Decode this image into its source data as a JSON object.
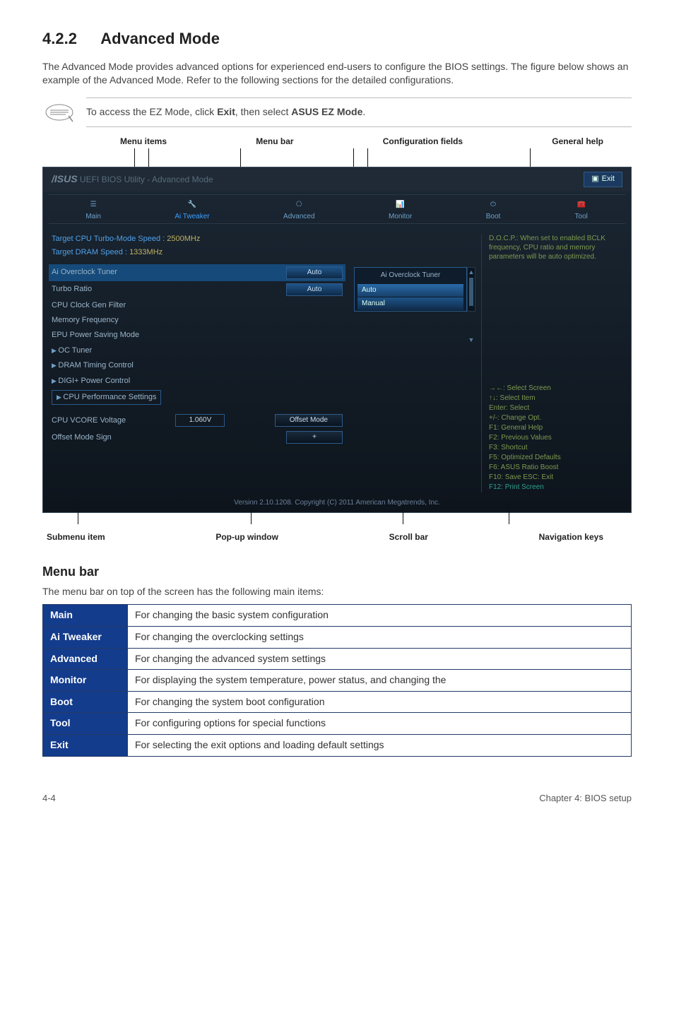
{
  "section": {
    "number": "4.2.2",
    "title": "Advanced Mode"
  },
  "intro": "The Advanced Mode provides advanced options for experienced end-users to configure the BIOS settings. The figure below shows an example of the Advanced Mode. Refer to the following sections for the detailed configurations.",
  "note": {
    "text": "To access the EZ Mode, click Exit, then select ASUS EZ Mode.",
    "bold1": "Exit",
    "bold2": "ASUS EZ Mode"
  },
  "labels_top": {
    "menu_items": "Menu items",
    "menu_bar": "Menu bar",
    "config_fields": "Configuration fields",
    "general_help": "General help"
  },
  "labels_bottom": {
    "submenu_item": "Submenu item",
    "popup": "Pop-up window",
    "scrollbar": "Scroll bar",
    "nav_keys": "Navigation keys"
  },
  "bios": {
    "brand": "/ISUS",
    "subbrand": "UEFI BIOS Utility - Advanced Mode",
    "exit_label": "Exit",
    "tabs": {
      "main": "Main",
      "ai": "Ai Tweaker",
      "advanced": "Advanced",
      "monitor": "Monitor",
      "boot": "Boot",
      "tool": "Tool"
    },
    "targets": {
      "cpu_turbo_label": "Target CPU Turbo-Mode Speed :",
      "cpu_turbo_val": "2500MHz",
      "dram_label": "Target DRAM Speed :",
      "dram_val": "1333MHz"
    },
    "items": {
      "ai_overclock": "Ai Overclock Tuner",
      "turbo_ratio": "Turbo Ratio",
      "cpu_clock_filter": "CPU Clock Gen Filter",
      "memory_freq": "Memory Frequency",
      "epu_saving": "EPU Power Saving Mode",
      "oc_tuner": "OC Tuner",
      "dram_timing": "DRAM Timing Control",
      "digi_power": "DIGI+ Power Control",
      "cpu_perf": "CPU Performance Settings",
      "cpu_vcore": "CPU VCORE Voltage",
      "vcore_val": "1.060V",
      "offset_label": "Offset Mode",
      "offset_sign": "Offset Mode Sign",
      "plus": "+"
    },
    "badges": {
      "auto": "Auto",
      "manual": "Manual"
    },
    "popup": {
      "title": "Ai Overclock Tuner",
      "opt_auto": "Auto",
      "opt_manual": "Manual"
    },
    "help": "D.O.C.P.: When set to enabled BCLK frequency, CPU ratio and memory parameters will be auto optimized.",
    "nav": {
      "l1": "→←: Select Screen",
      "l2": "↑↓: Select Item",
      "l3": "Enter: Select",
      "l4": "+/-: Change Opt.",
      "l5": "F1: General Help",
      "l6": "F2: Previous Values",
      "l7": "F3: Shortcut",
      "l8": "F5: Optimized Defaults",
      "l9": "F6: ASUS Ratio Boost",
      "l10": "F10: Save  ESC: Exit",
      "l11": "F12: Print Screen"
    },
    "footer": "Version 2.10.1208. Copyright (C) 2011 American Megatrends, Inc."
  },
  "menu_bar_section": {
    "title": "Menu bar",
    "desc": "The menu bar on top of the screen has the following main items:",
    "rows": [
      {
        "k": "Main",
        "v": "For changing the basic system configuration"
      },
      {
        "k": "Ai Tweaker",
        "v": "For changing the overclocking settings"
      },
      {
        "k": "Advanced",
        "v": "For changing the advanced system settings"
      },
      {
        "k": "Monitor",
        "v": "For displaying the system temperature, power status, and changing the"
      },
      {
        "k": "Boot",
        "v": "For changing the system boot configuration"
      },
      {
        "k": "Tool",
        "v": "For configuring options for special functions"
      },
      {
        "k": "Exit",
        "v": "For selecting the exit options and loading default settings"
      }
    ]
  },
  "page_footer": {
    "left": "4-4",
    "right": "Chapter 4: BIOS setup"
  }
}
